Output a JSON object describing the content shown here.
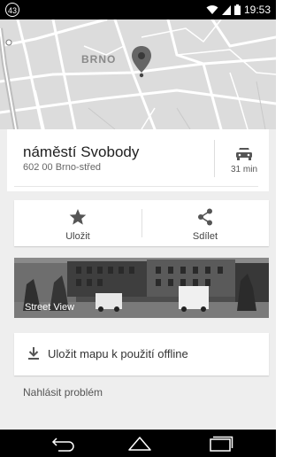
{
  "status_bar": {
    "notification_count": "43",
    "time": "19:53",
    "icons": [
      "wifi-icon",
      "signal-icon",
      "battery-icon"
    ]
  },
  "map": {
    "city_label": "BRNO"
  },
  "place": {
    "name": "náměstí Svobody",
    "address": "602 00 Brno-střed",
    "drive_time": "31 min"
  },
  "actions": {
    "save_label": "Uložit",
    "share_label": "Sdílet"
  },
  "street_view": {
    "label": "Street View"
  },
  "offline": {
    "label": "Uložit mapu k použití offline"
  },
  "report": {
    "label": "Nahlásit problém"
  },
  "nav_bar": {
    "buttons": [
      "back-icon",
      "home-icon",
      "recents-icon"
    ]
  }
}
